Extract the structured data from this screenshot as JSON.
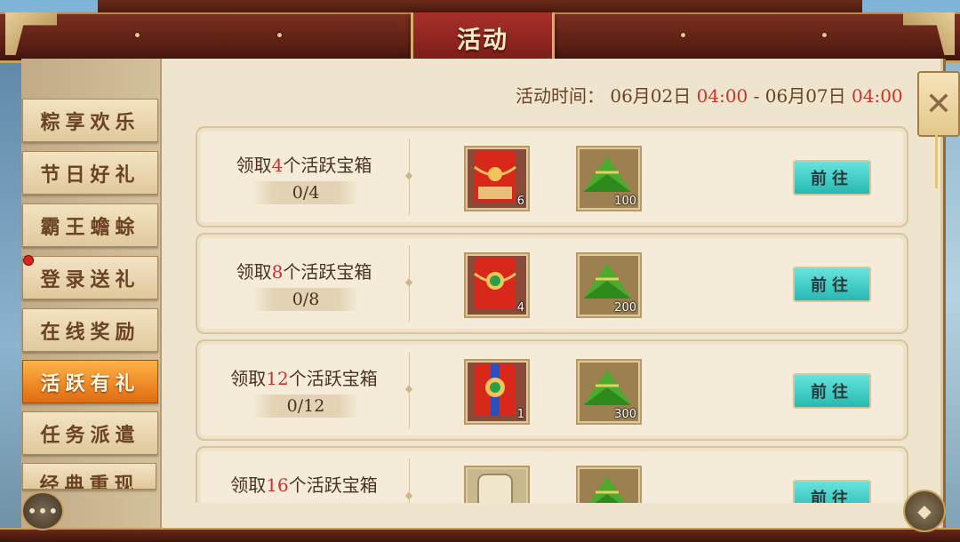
{
  "window": {
    "title": "活动"
  },
  "event_time": {
    "label": "活动时间：",
    "start_date": "06月02日",
    "start_time": "04:00",
    "separator": "-",
    "end_date": "06月07日",
    "end_time": "04:00"
  },
  "sidebar": {
    "tabs": [
      {
        "label": "粽享欢乐",
        "active": false
      },
      {
        "label": "节日好礼",
        "active": false
      },
      {
        "label": "霸王蟾蜍",
        "active": false
      },
      {
        "label": "登录送礼",
        "active": false,
        "notification": true
      },
      {
        "label": "在线奖励",
        "active": false
      },
      {
        "label": "活跃有礼",
        "active": true
      },
      {
        "label": "任务派遣",
        "active": false
      },
      {
        "label": "经典重现",
        "active": false
      }
    ]
  },
  "rows": [
    {
      "prefix": "领取",
      "num": "4",
      "suffix": "个活跃宝箱",
      "progress": "0/4",
      "rewards": [
        {
          "icon": "red-envelope-icon",
          "count": "6"
        },
        {
          "icon": "zongzi-icon",
          "count": "100"
        }
      ],
      "button": "前往"
    },
    {
      "prefix": "领取",
      "num": "8",
      "suffix": "个活跃宝箱",
      "progress": "0/8",
      "rewards": [
        {
          "icon": "jade-red-envelope-icon",
          "count": "4"
        },
        {
          "icon": "zongzi-icon",
          "count": "200"
        }
      ],
      "button": "前往"
    },
    {
      "prefix": "领取",
      "num": "12",
      "suffix": "个活跃宝箱",
      "progress": "0/12",
      "rewards": [
        {
          "icon": "blue-jade-envelope-icon",
          "count": "1"
        },
        {
          "icon": "zongzi-icon",
          "count": "300"
        }
      ],
      "button": "前往"
    },
    {
      "prefix": "领取",
      "num": "16",
      "suffix": "个活跃宝箱",
      "progress": "",
      "rewards": [
        {
          "icon": "scroll-pouch-icon",
          "count": ""
        },
        {
          "icon": "zongzi-icon",
          "count": ""
        }
      ],
      "button": "前往"
    }
  ],
  "colors": {
    "accent_red": "#c8342a",
    "active_tab": "#f08a20",
    "go_button": "#3cc8c2"
  }
}
